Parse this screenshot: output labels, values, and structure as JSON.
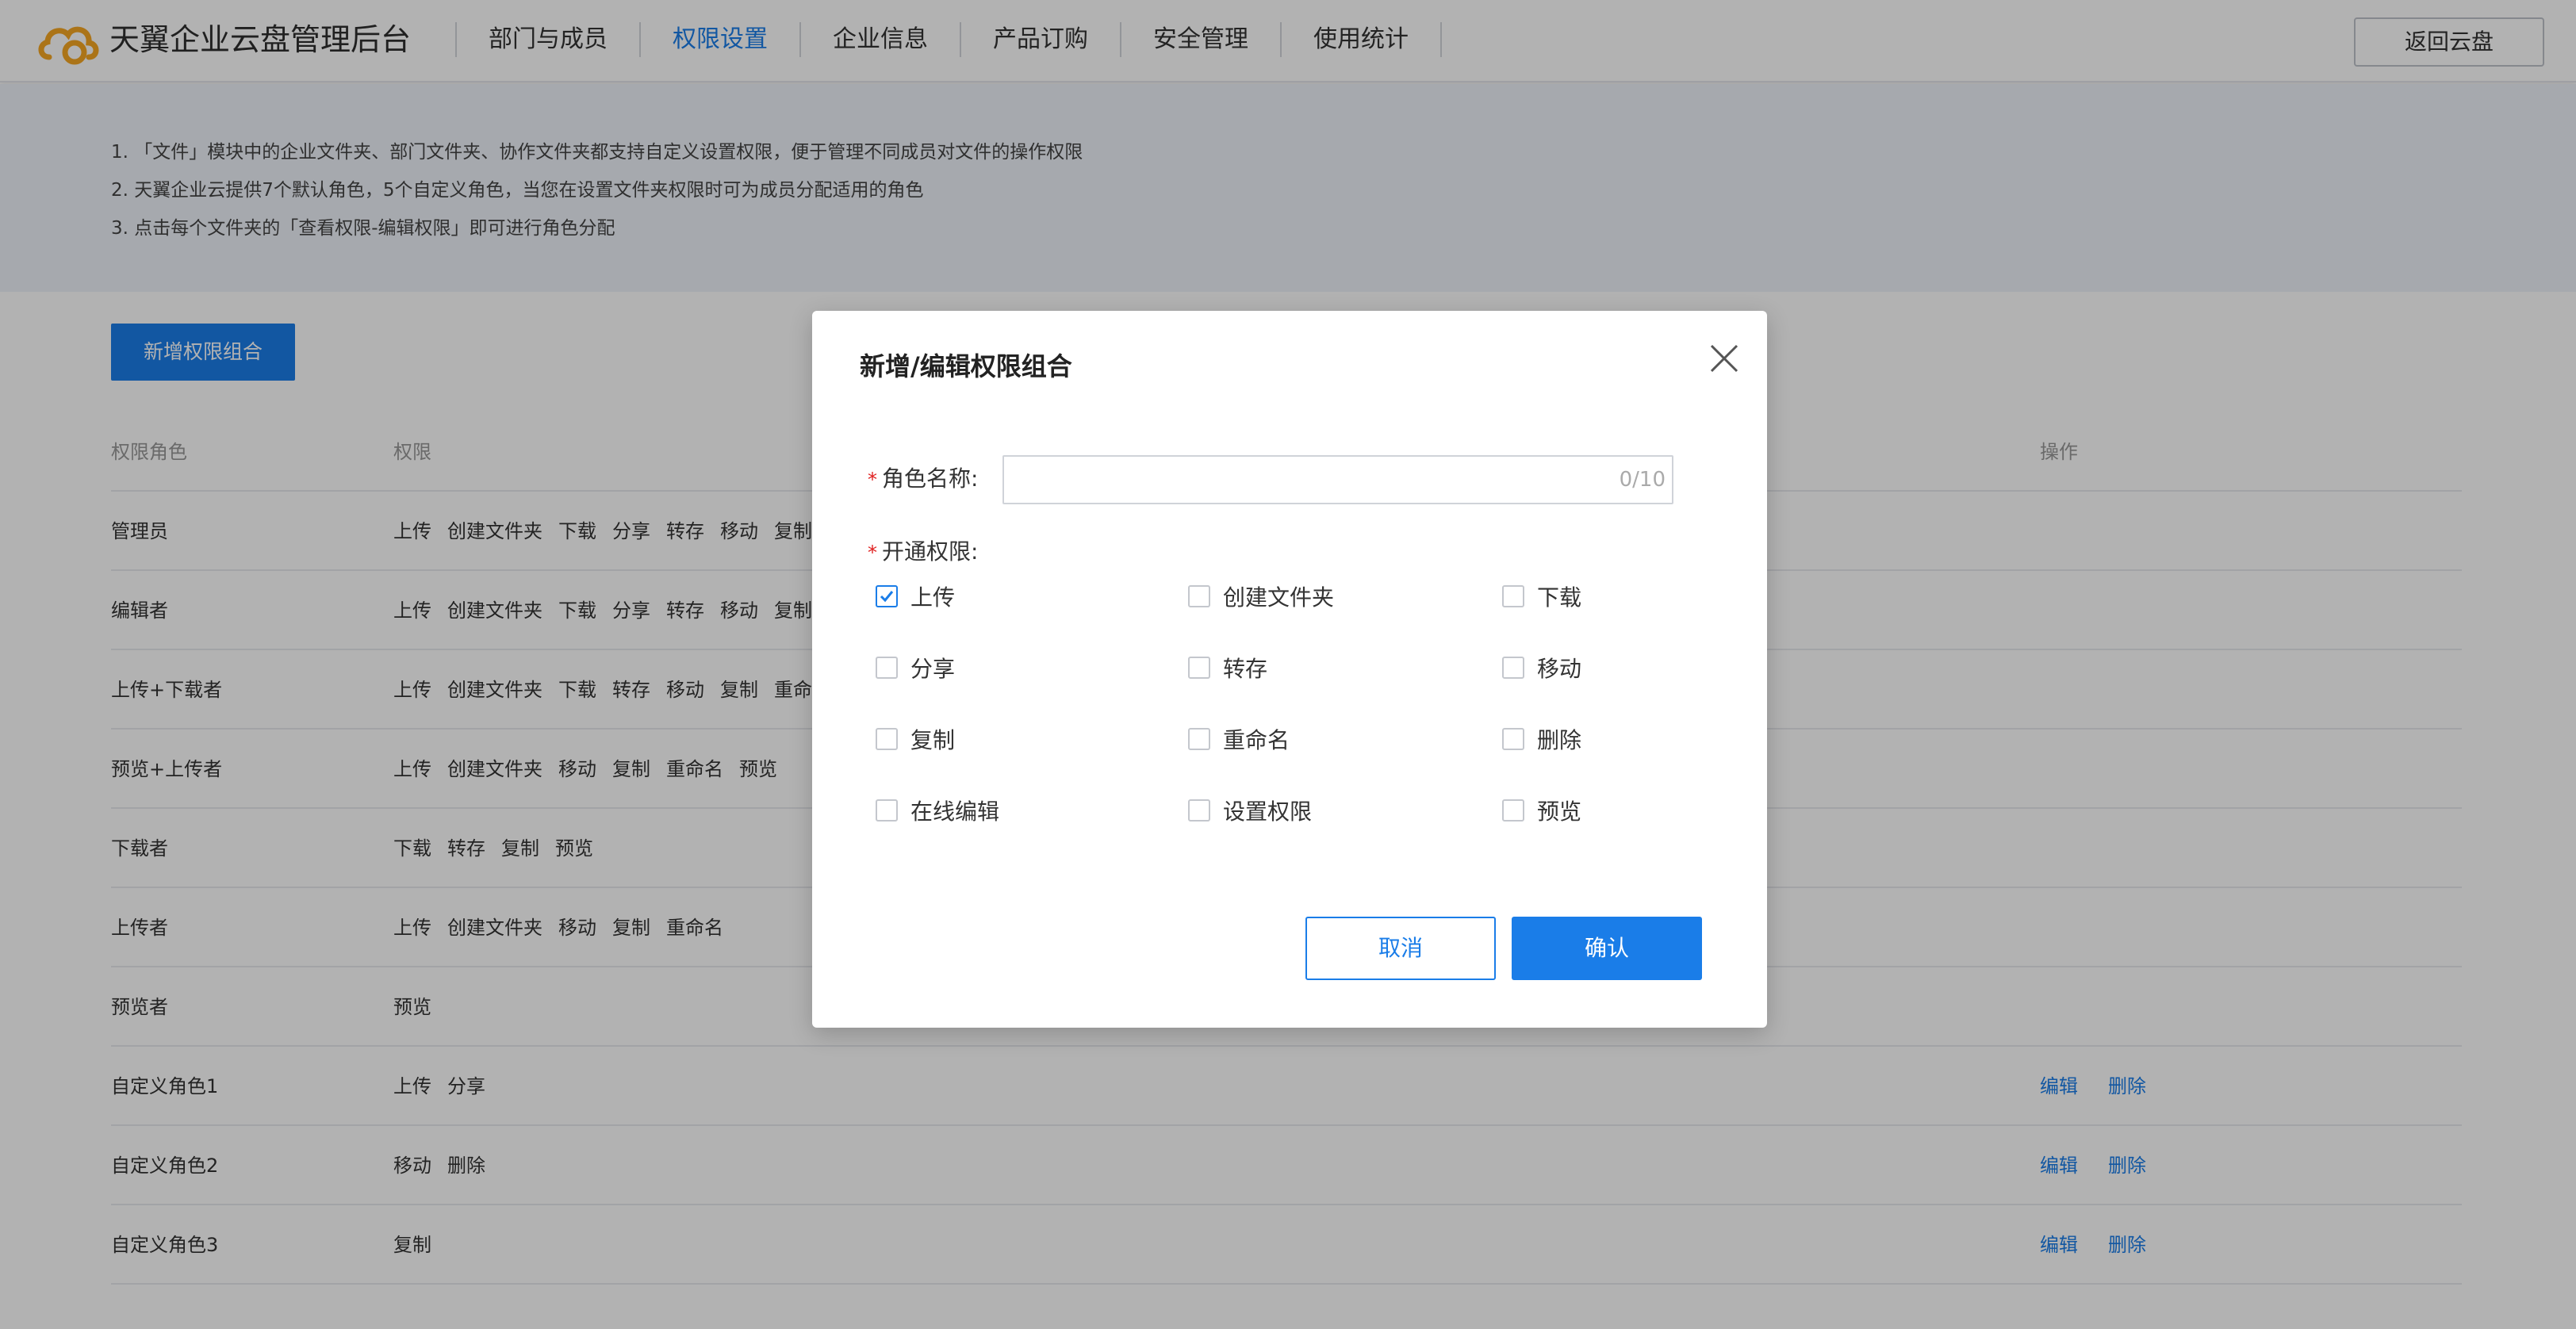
{
  "header": {
    "title": "天翼企业云盘管理后台",
    "nav": [
      {
        "label": "部门与成员"
      },
      {
        "label": "权限设置"
      },
      {
        "label": "企业信息"
      },
      {
        "label": "产品订购"
      },
      {
        "label": "安全管理"
      },
      {
        "label": "使用统计"
      }
    ],
    "back_label": "返回云盘"
  },
  "notice": [
    "1. 「文件」模块中的企业文件夹、部门文件夹、协作文件夹都支持自定义设置权限，便于管理不同成员对文件的操作权限",
    "2. 天翼企业云提供7个默认角色，5个自定义角色，当您在设置文件夹权限时可为成员分配适用的角色",
    "3. 点击每个文件夹的「查看权限-编辑权限」即可进行角色分配"
  ],
  "add_button": "新增权限组合",
  "table": {
    "headers": {
      "role": "权限角色",
      "perms": "权限",
      "ops": "操作"
    },
    "rows": [
      {
        "role": "管理员",
        "perms": [
          "上传",
          "创建文件夹",
          "下载",
          "分享",
          "转存",
          "移动",
          "复制"
        ]
      },
      {
        "role": "编辑者",
        "perms": [
          "上传",
          "创建文件夹",
          "下载",
          "分享",
          "转存",
          "移动",
          "复制"
        ]
      },
      {
        "role": "上传+下载者",
        "perms": [
          "上传",
          "创建文件夹",
          "下载",
          "转存",
          "移动",
          "复制",
          "重命"
        ]
      },
      {
        "role": "预览+上传者",
        "perms": [
          "上传",
          "创建文件夹",
          "移动",
          "复制",
          "重命名",
          "预览"
        ]
      },
      {
        "role": "下载者",
        "perms": [
          "下载",
          "转存",
          "复制",
          "预览"
        ]
      },
      {
        "role": "上传者",
        "perms": [
          "上传",
          "创建文件夹",
          "移动",
          "复制",
          "重命名"
        ]
      },
      {
        "role": "预览者",
        "perms": [
          "预览"
        ]
      },
      {
        "role": "自定义角色1",
        "perms": [
          "上传",
          "分享"
        ],
        "ops": [
          "编辑",
          "删除"
        ]
      },
      {
        "role": "自定义角色2",
        "perms": [
          "移动",
          "删除"
        ],
        "ops": [
          "编辑",
          "删除"
        ]
      },
      {
        "role": "自定义角色3",
        "perms": [
          "复制"
        ],
        "ops": [
          "编辑",
          "删除"
        ]
      }
    ]
  },
  "modal": {
    "title": "新增/编辑权限组合",
    "required_mark": "*",
    "name_label": "角色名称:",
    "name_value": "",
    "name_counter": "0/10",
    "perm_label": "开通权限:",
    "permissions": [
      [
        {
          "label": "上传",
          "checked": true
        },
        {
          "label": "创建文件夹",
          "checked": false
        },
        {
          "label": "下载",
          "checked": false
        }
      ],
      [
        {
          "label": "分享",
          "checked": false
        },
        {
          "label": "转存",
          "checked": false
        },
        {
          "label": "移动",
          "checked": false
        }
      ],
      [
        {
          "label": "复制",
          "checked": false
        },
        {
          "label": "重命名",
          "checked": false
        },
        {
          "label": "删除",
          "checked": false
        }
      ],
      [
        {
          "label": "在线编辑",
          "checked": false
        },
        {
          "label": "设置权限",
          "checked": false
        },
        {
          "label": "预览",
          "checked": false
        }
      ]
    ],
    "cancel_label": "取消",
    "confirm_label": "确认"
  },
  "colors": {
    "accent": "#1a7de8",
    "logo": "#f5a623",
    "required": "#e02020",
    "overlay": "rgba(0,0,0,0.30)"
  },
  "icons": {
    "logo": "cloud-logo-icon",
    "close": "close-icon",
    "check": "checkmark-icon"
  }
}
